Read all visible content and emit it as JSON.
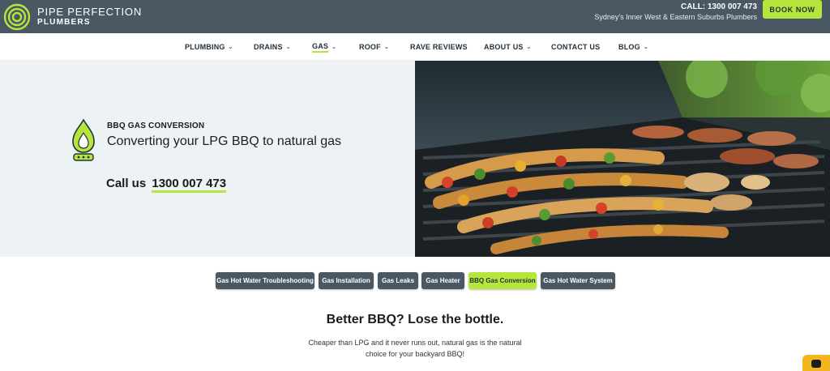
{
  "brand": {
    "name_line1": "PIPE PERFECTION",
    "name_line2": "PLUMBERS"
  },
  "header": {
    "call": "CALL: 1300 007 473",
    "tagline": "Sydney's Inner West & Eastern Suburbs Plumbers",
    "book_label": "BOOK NOW"
  },
  "nav": {
    "items": [
      {
        "label": "PLUMBING",
        "has_dropdown": true
      },
      {
        "label": "DRAINS",
        "has_dropdown": true
      },
      {
        "label": "GAS",
        "has_dropdown": true,
        "active": true
      },
      {
        "label": "ROOF",
        "has_dropdown": true
      },
      {
        "label": "RAVE REVIEWS",
        "has_dropdown": false
      },
      {
        "label": "ABOUT US",
        "has_dropdown": true
      },
      {
        "label": "CONTACT US",
        "has_dropdown": false
      },
      {
        "label": "BLOG",
        "has_dropdown": true
      }
    ]
  },
  "hero": {
    "kicker": "BBQ GAS CONVERSION",
    "title": "Converting your LPG BBQ to natural gas",
    "call_prefix": "Call us",
    "call_number": "1300 007 473",
    "icon": "gas-flame-icon",
    "image": "bbq-grill-photo"
  },
  "subnav": {
    "pills": [
      {
        "label": "Gas Hot Water Troubleshooting"
      },
      {
        "label": "Gas Installation"
      },
      {
        "label": "Gas Leaks"
      },
      {
        "label": "Gas Heater"
      },
      {
        "label": "BBQ Gas Conversion",
        "active": true
      },
      {
        "label": "Gas Hot Water System"
      }
    ]
  },
  "content": {
    "heading": "Better BBQ? Lose the bottle.",
    "body": "Cheaper than LPG and it never runs out, natural gas is the natural choice for your backyard BBQ!"
  },
  "colors": {
    "topbar": "#4a5864",
    "accent": "#b5e63c",
    "hero_bg": "#edf2f5",
    "chat": "#f2b61e"
  }
}
